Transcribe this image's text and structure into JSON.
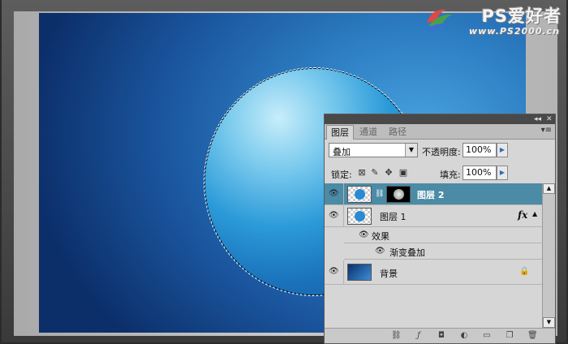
{
  "watermark": {
    "brand": "PS爱好者",
    "url": "www.PS2000.cn"
  },
  "layers_panel": {
    "tabs": [
      {
        "label": "图层",
        "active": true
      },
      {
        "label": "通道",
        "active": false
      },
      {
        "label": "路径",
        "active": false
      }
    ],
    "blend_mode": "叠加",
    "opacity_label": "不透明度:",
    "opacity_value": "100%",
    "lock_label": "锁定:",
    "fill_label": "填充:",
    "fill_value": "100%",
    "layers": [
      {
        "name": "图层 2",
        "selected": true,
        "visible": true,
        "has_mask": true
      },
      {
        "name": "图层 1",
        "selected": false,
        "visible": true,
        "has_fx": true,
        "fx_label": "fx"
      },
      {
        "name": "背景",
        "selected": false,
        "visible": true,
        "locked": true
      }
    ],
    "effects_label": "效果",
    "gradient_overlay_label": "渐变叠加"
  },
  "colors": {
    "canvas_dark": "#0c2f6a",
    "canvas_light": "#4aa3de",
    "selected_layer": "#4b8ba6"
  }
}
